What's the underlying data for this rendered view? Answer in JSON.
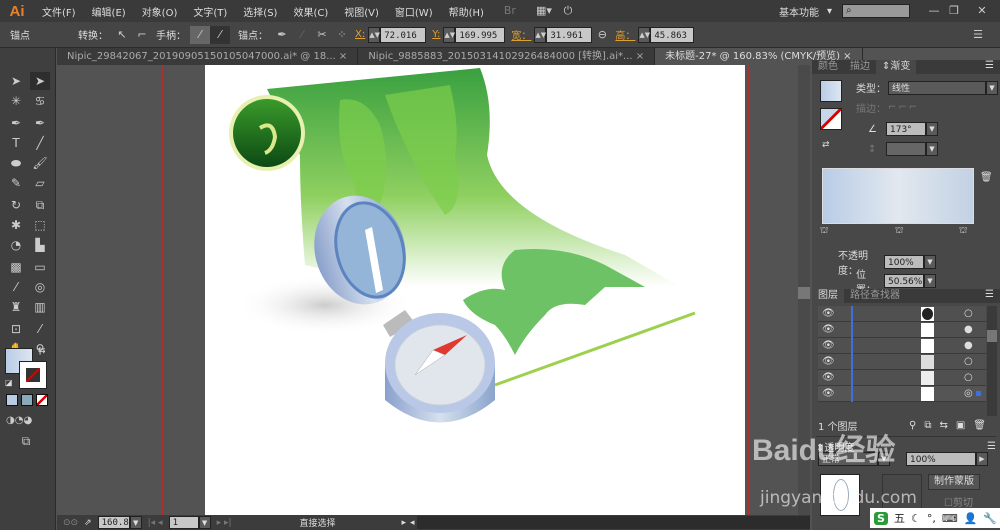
{
  "app": {
    "logo": "Ai",
    "workspace": "基本功能",
    "search_placeholder": ""
  },
  "menu": [
    "文件(F)",
    "编辑(E)",
    "对象(O)",
    "文字(T)",
    "选择(S)",
    "效果(C)",
    "视图(V)",
    "窗口(W)",
    "帮助(H)"
  ],
  "control": {
    "mode": "锚点",
    "convert_label": "转换：",
    "handle_label": "手柄：",
    "anchor_label": "锚点：",
    "x_label": "X:",
    "x": "72.016 mm",
    "y_label": "Y:",
    "y": "169.995 mm",
    "w_label": "宽：",
    "w": "31.961 mm",
    "h_label": "高：",
    "h": "45.863 mm"
  },
  "tabs": [
    {
      "label": "Nipic_29842067_20190905150105047000.ai* @ 18...",
      "close": "×"
    },
    {
      "label": "Nipic_9885883_20150314102926484000 [转换].ai*...",
      "close": "×"
    },
    {
      "label": "未标题-27* @ 160.83% (CMYK/预览)",
      "close": "×"
    }
  ],
  "status": {
    "zoom": "160.83",
    "page": "1",
    "tool": "直接选择"
  },
  "gradient_panel": {
    "tabs": [
      "颜色",
      "描边",
      "渐变"
    ],
    "type_label": "类型：",
    "type": "线性",
    "stroke_label": "描边：",
    "angle": "173°",
    "opacity_label": "不透明度：",
    "opacity": "100%",
    "location_label": "位置：",
    "location": "50.56%",
    "colors": {
      "start": "#b9cce6",
      "mid": "#e2e8ef",
      "end": "#c2d1e4"
    }
  },
  "layers_panel": {
    "tabs": [
      "图层",
      "路径查找器"
    ],
    "count": "1 个图层",
    "layer_color": "#3e6fe0",
    "rows": 6
  },
  "transparency_panel": {
    "title": "透明度",
    "mode": "正常",
    "opacity": "100%",
    "make_mask": "制作蒙版",
    "clip": "剪切"
  },
  "watermark": {
    "text": "Baidu经验",
    "url": "jingyan.baidu.com"
  },
  "ime": {
    "label": "五"
  }
}
